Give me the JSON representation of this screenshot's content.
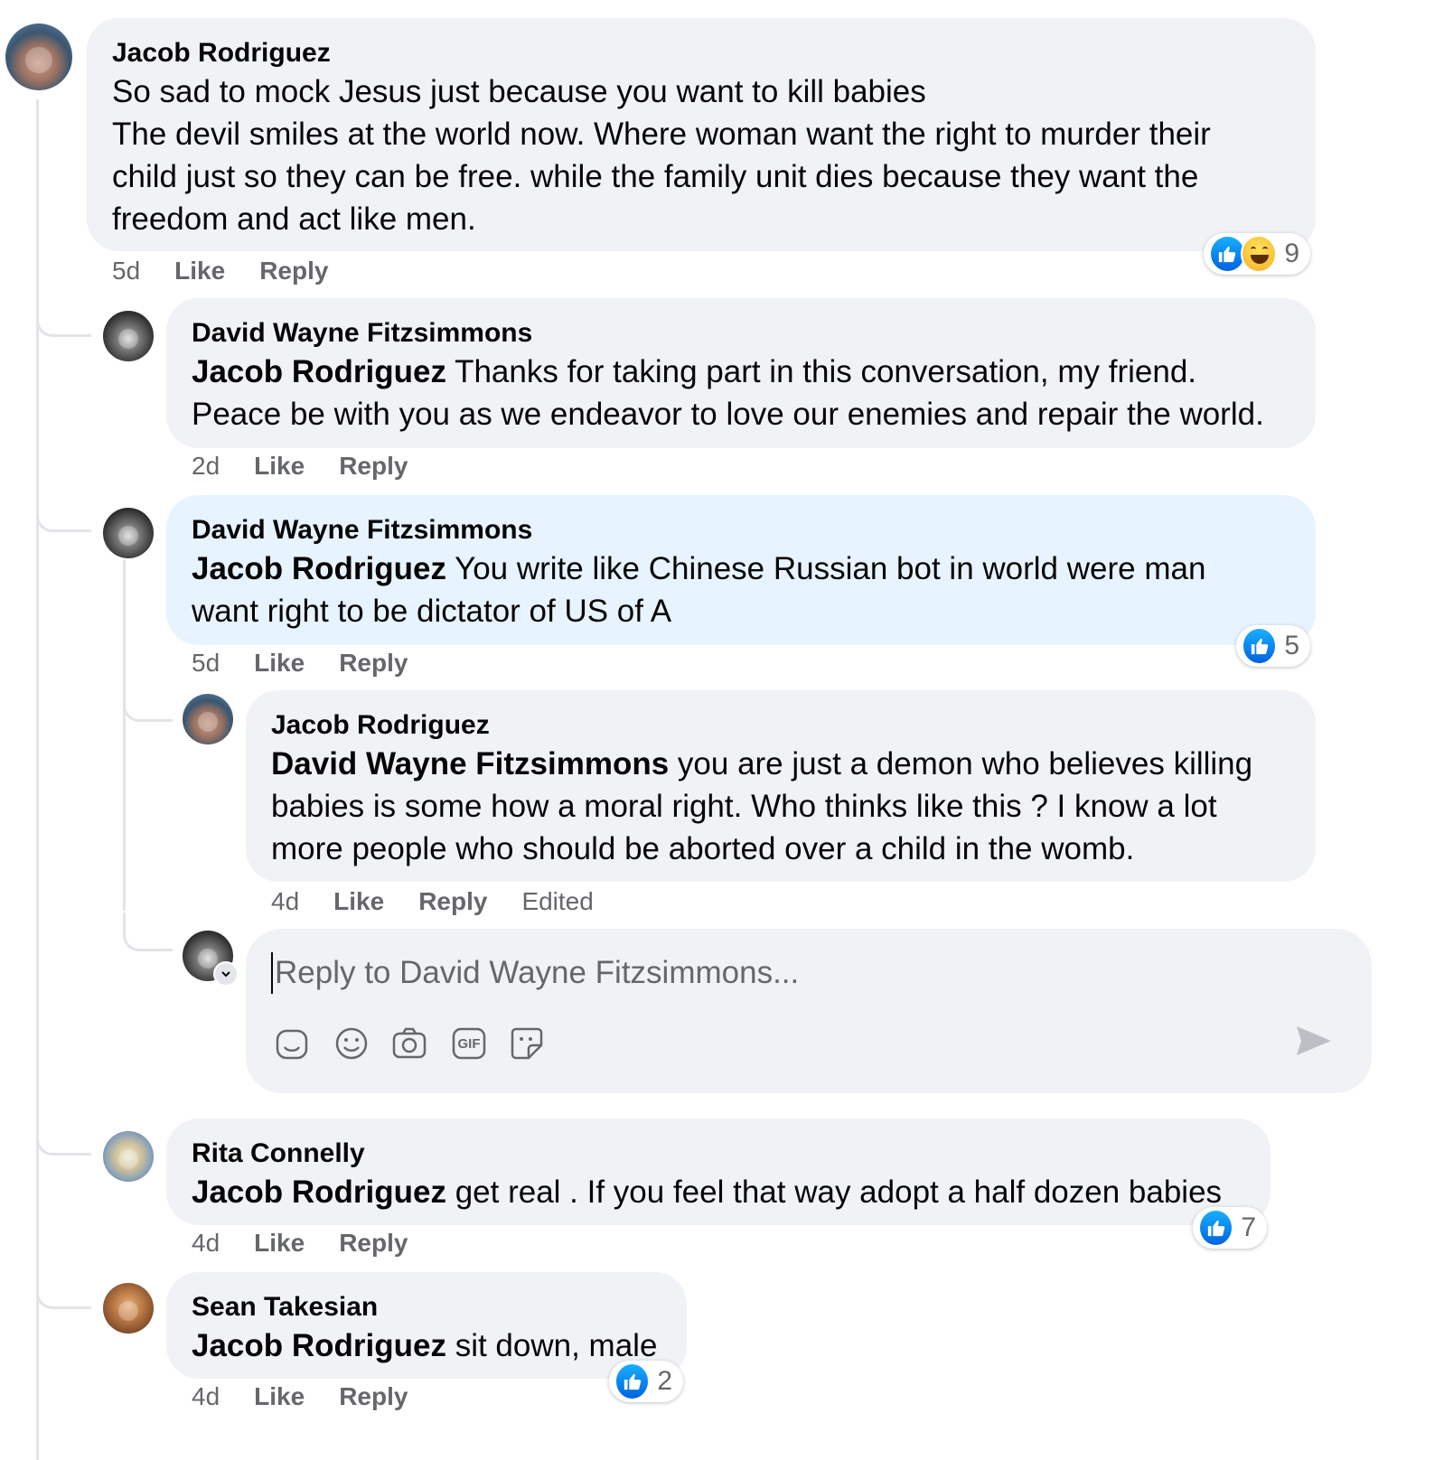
{
  "comments": {
    "c1": {
      "author": "Jacob Rodriguez",
      "line1": "So sad to mock Jesus just because you want to kill babies",
      "line2": "The devil smiles at the world now. Where woman want the right to murder their",
      "line3": "child just so they can be free. while the family unit dies because they want the",
      "line4": "freedom and act like men.",
      "time": "5d",
      "like": "Like",
      "reply": "Reply",
      "reaction_count": "9"
    },
    "c2": {
      "author": "David Wayne Fitzsimmons",
      "mention": "Jacob Rodriguez",
      "line1": " Thanks for taking part in this conversation, my friend.",
      "line2": "Peace be with you as we endeavor to love our enemies and repair the world.",
      "time": "2d",
      "like": "Like",
      "reply": "Reply"
    },
    "c3": {
      "author": "David Wayne Fitzsimmons",
      "mention": "Jacob Rodriguez",
      "line1": " You write like Chinese Russian bot in world were man",
      "line2": "want right to be dictator of US of A",
      "time": "5d",
      "like": "Like",
      "reply": "Reply",
      "reaction_count": "5"
    },
    "c4": {
      "author": "Jacob Rodriguez",
      "mention": "David Wayne Fitzsimmons",
      "line1": " you are just a demon who believes killing",
      "line2": "babies is some how a moral right. Who thinks like this ? I know a lot",
      "line3": "more people who should be aborted over a child in the womb.",
      "time": "4d",
      "like": "Like",
      "reply": "Reply",
      "edited": "Edited"
    },
    "c5": {
      "author": "Rita Connelly",
      "mention": "Jacob Rodriguez",
      "line1": " get real . If you feel that way adopt a half dozen babies",
      "time": "4d",
      "like": "Like",
      "reply": "Reply",
      "reaction_count": "7"
    },
    "c6": {
      "author": "Sean Takesian",
      "mention": "Jacob Rodriguez",
      "line1": " sit down, male",
      "time": "4d",
      "like": "Like",
      "reply": "Reply",
      "reaction_count": "2"
    }
  },
  "composer": {
    "placeholder": "Reply to David Wayne Fitzsimmons...",
    "tools": [
      "avatar-sticker-icon",
      "emoji-icon",
      "camera-icon",
      "gif-icon",
      "sticker-icon"
    ],
    "gif_label": "GIF"
  },
  "colors": {
    "bubble": "#f0f2f5",
    "highlight_bubble": "#e7f3ff",
    "like_blue": "#0866ff",
    "meta_gray": "#65676b"
  }
}
